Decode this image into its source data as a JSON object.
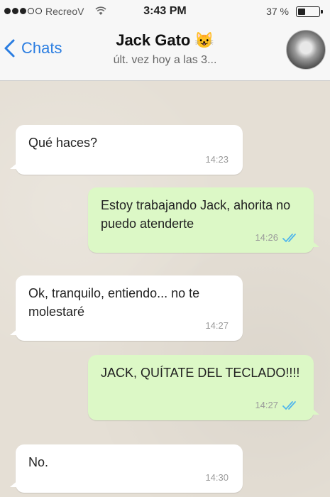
{
  "status_bar": {
    "carrier": "RecreoV",
    "time": "3:43 PM",
    "battery_pct": "37 %",
    "battery_level": 0.37,
    "signal_strength": 3
  },
  "header": {
    "back_label": "Chats",
    "contact_name": "Jack Gato",
    "contact_emoji": "😺",
    "contact_status": "últ. vez hoy a las 3..."
  },
  "messages": [
    {
      "direction": "in",
      "text": "Qué haces?",
      "time": "14:23"
    },
    {
      "direction": "out",
      "text": "Estoy trabajando Jack, ahorita no puedo atenderte",
      "time": "14:26",
      "read": true
    },
    {
      "direction": "in",
      "text": "Ok, tranquilo, entiendo... no te molestaré",
      "time": "14:27"
    },
    {
      "direction": "out",
      "text": "JACK, QUÍTATE DEL TECLADO!!!!",
      "time": "14:27",
      "read": true
    },
    {
      "direction": "in",
      "text": "No.",
      "time": "14:30"
    }
  ],
  "colors": {
    "incoming_bubble": "#ffffff",
    "outgoing_bubble": "#dcf8c6",
    "accent": "#2a7de1",
    "read_ticks": "#4fb6ec"
  }
}
